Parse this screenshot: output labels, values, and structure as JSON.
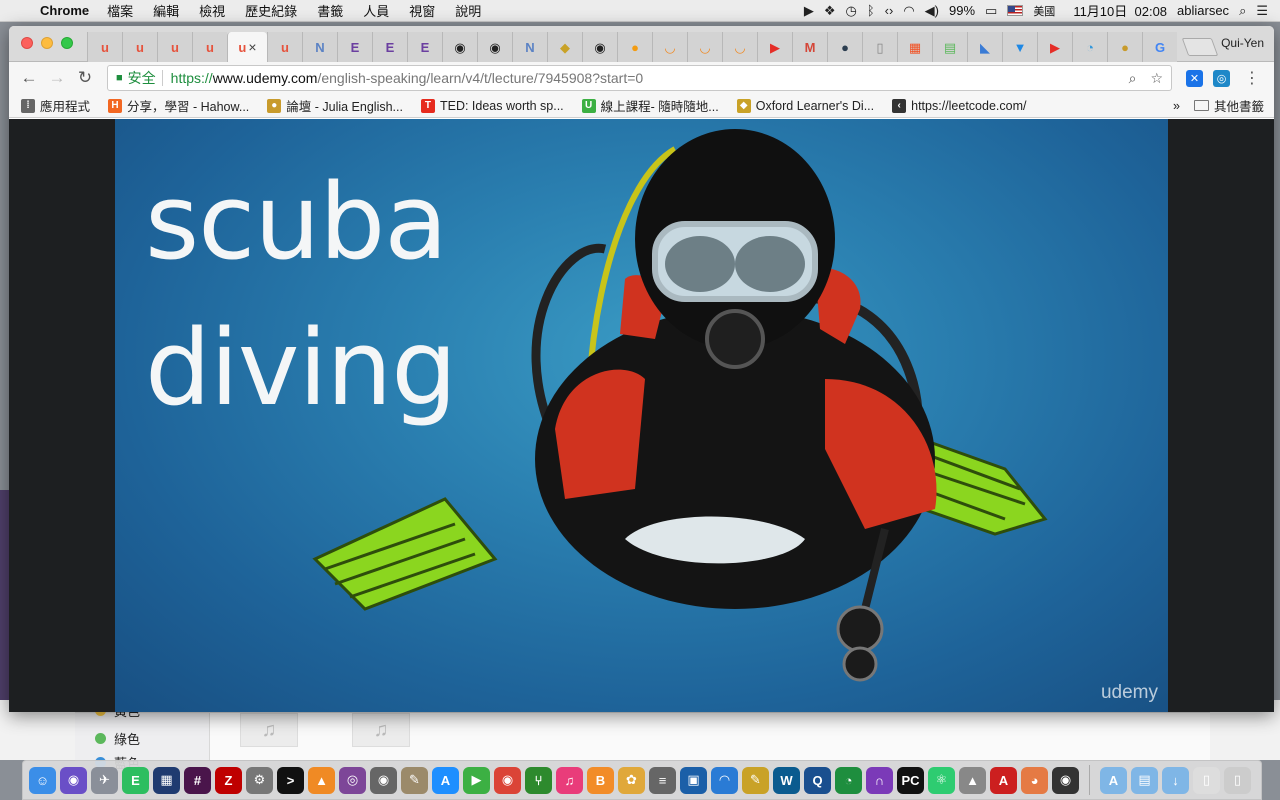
{
  "menubar": {
    "app_name": "Chrome",
    "menus": [
      "檔案",
      "編輯",
      "檢視",
      "歷史紀錄",
      "書籤",
      "人員",
      "視窗",
      "說明"
    ],
    "battery": "99%",
    "input_source": "美國",
    "clock": "11月10日  02:08",
    "user": "abliarsec"
  },
  "browser": {
    "profile": "Qui-Yen",
    "tabs": [
      {
        "icon": "udemy-icon",
        "glyph": "u",
        "color": "#e6533d"
      },
      {
        "icon": "udemy-icon",
        "glyph": "u",
        "color": "#e6533d"
      },
      {
        "icon": "udemy-icon",
        "glyph": "u",
        "color": "#e6533d"
      },
      {
        "icon": "udemy-icon",
        "glyph": "u",
        "color": "#e6533d"
      },
      {
        "icon": "udemy-icon",
        "glyph": "u",
        "color": "#e6533d",
        "active": true
      },
      {
        "icon": "udemy-icon",
        "glyph": "u",
        "color": "#e6533d"
      },
      {
        "icon": "nb-icon",
        "glyph": "N",
        "color": "#5b82c4"
      },
      {
        "icon": "e-icon",
        "glyph": "E",
        "color": "#6b3fa0"
      },
      {
        "icon": "e-icon",
        "glyph": "E",
        "color": "#6b3fa0"
      },
      {
        "icon": "e-icon",
        "glyph": "E",
        "color": "#6b3fa0"
      },
      {
        "icon": "github-icon",
        "glyph": "◉",
        "color": "#222222"
      },
      {
        "icon": "github-icon",
        "glyph": "◉",
        "color": "#222222"
      },
      {
        "icon": "nb-icon",
        "glyph": "N",
        "color": "#5b82c4"
      },
      {
        "icon": "oxford-icon",
        "glyph": "◆",
        "color": "#c9a227"
      },
      {
        "icon": "github-icon",
        "glyph": "◉",
        "color": "#222222"
      },
      {
        "icon": "d4-icon",
        "glyph": "●",
        "color": "#f39c12"
      },
      {
        "icon": "orange-ring-icon",
        "glyph": "◡",
        "color": "#f08a24"
      },
      {
        "icon": "orange-ring-icon",
        "glyph": "◡",
        "color": "#f08a24"
      },
      {
        "icon": "orange-ring-icon",
        "glyph": "◡",
        "color": "#f08a24"
      },
      {
        "icon": "youtube-icon",
        "glyph": "▶",
        "color": "#e52d27"
      },
      {
        "icon": "gmail-icon",
        "glyph": "M",
        "color": "#d44638"
      },
      {
        "icon": "dark-circle-icon",
        "glyph": "●",
        "color": "#2c3e50"
      },
      {
        "icon": "page-icon",
        "glyph": "▯",
        "color": "#888888"
      },
      {
        "icon": "microsoft-icon",
        "glyph": "▦",
        "color": "#f25022"
      },
      {
        "icon": "sheet-icon",
        "glyph": "▤",
        "color": "#5cb85c"
      },
      {
        "icon": "blue-book-icon",
        "glyph": "◣",
        "color": "#3a7bd5"
      },
      {
        "icon": "filter-icon",
        "glyph": "▼",
        "color": "#1e88e5"
      },
      {
        "icon": "youtube-icon",
        "glyph": "▶",
        "color": "#e52d27"
      },
      {
        "icon": "swirl-icon",
        "glyph": "◔",
        "color": "#3498db"
      },
      {
        "icon": "lb-icon",
        "glyph": "●",
        "color": "#c89b2c"
      },
      {
        "icon": "google-icon",
        "glyph": "G",
        "color": "#4285f4"
      }
    ],
    "omnibox": {
      "secure_label": "安全",
      "url_scheme": "https://",
      "url_host": "www.udemy.com",
      "url_path": "/english-speaking/learn/v4/t/lecture/7945908?start=0"
    },
    "bookmarks": [
      {
        "icon": "apps-grid-icon",
        "label": "應用程式",
        "color": "#666666",
        "glyph": "⁞"
      },
      {
        "icon": "hahow-icon",
        "label": "分享，學習 - Hahow...",
        "color": "#f26722",
        "glyph": "H"
      },
      {
        "icon": "lb-icon",
        "label": "論壇 - Julia English...",
        "color": "#c89b2c",
        "glyph": "●"
      },
      {
        "icon": "ted-icon",
        "label": "TED: Ideas worth sp...",
        "color": "#e62b1e",
        "glyph": "T"
      },
      {
        "icon": "u-green-icon",
        "label": "線上課程- 隨時隨地...",
        "color": "#3cb043",
        "glyph": "U"
      },
      {
        "icon": "oxford-icon",
        "label": "Oxford Learner's Di...",
        "color": "#c9a227",
        "glyph": "◆"
      },
      {
        "icon": "leetcode-icon",
        "label": "https://leetcode.com/",
        "color": "#333333",
        "glyph": "‹"
      }
    ],
    "other_bookmarks": "其他書籤"
  },
  "video": {
    "caption_line1": "scuba",
    "caption_line2": "diving",
    "watermark": "udemy"
  },
  "background_finder": {
    "tags": [
      {
        "label": "黃色",
        "color": "#f5c542"
      },
      {
        "label": "綠色",
        "color": "#5cb85c"
      },
      {
        "label": "藍色",
        "color": "#3a8fd8"
      }
    ]
  },
  "dock": {
    "apps": [
      {
        "name": "finder-icon",
        "color": "#3b8ee8",
        "glyph": "☺"
      },
      {
        "name": "siri-icon",
        "color": "#6a4fc7",
        "glyph": "◉"
      },
      {
        "name": "launchpad-icon",
        "color": "#8a8f99",
        "glyph": "✈"
      },
      {
        "name": "evernote-icon",
        "color": "#2dbe60",
        "glyph": "E"
      },
      {
        "name": "window-app-icon",
        "color": "#1f3b70",
        "glyph": "▦"
      },
      {
        "name": "slack-icon",
        "color": "#4a154b",
        "glyph": "#"
      },
      {
        "name": "filezilla-icon",
        "color": "#bf0000",
        "glyph": "Z"
      },
      {
        "name": "system-preferences-icon",
        "color": "#777777",
        "glyph": "⚙"
      },
      {
        "name": "terminal-icon",
        "color": "#111111",
        "glyph": ">"
      },
      {
        "name": "vlc-icon",
        "color": "#f08a24",
        "glyph": "▲"
      },
      {
        "name": "tor-icon",
        "color": "#7d4698",
        "glyph": "◎"
      },
      {
        "name": "screenshot-icon",
        "color": "#666666",
        "glyph": "◉"
      },
      {
        "name": "preview-icon",
        "color": "#9b8a6a",
        "glyph": "✎"
      },
      {
        "name": "app-store-icon",
        "color": "#1e8fff",
        "glyph": "A"
      },
      {
        "name": "facetime-icon",
        "color": "#3cb043",
        "glyph": "▶"
      },
      {
        "name": "chrome-icon",
        "color": "#db4437",
        "glyph": "◉"
      },
      {
        "name": "sourcetree-icon",
        "color": "#2d8a2d",
        "glyph": "⑂"
      },
      {
        "name": "itunes-icon",
        "color": "#e93c7a",
        "glyph": "♫"
      },
      {
        "name": "ibooks-icon",
        "color": "#f28c28",
        "glyph": "B"
      },
      {
        "name": "photos-icon",
        "color": "#e0a83a",
        "glyph": "✿"
      },
      {
        "name": "database-icon",
        "color": "#666666",
        "glyph": "≡"
      },
      {
        "name": "virtualbox-icon",
        "color": "#1b5fa8",
        "glyph": "▣"
      },
      {
        "name": "wifi-app-icon",
        "color": "#2a7bd5",
        "glyph": "◠"
      },
      {
        "name": "notes-icon",
        "color": "#c9a227",
        "glyph": "✎"
      },
      {
        "name": "w-app-icon",
        "color": "#0a5b8f",
        "glyph": "W"
      },
      {
        "name": "search-app-icon",
        "color": "#1a4f8f",
        "glyph": "Q"
      },
      {
        "name": "stats-icon",
        "color": "#1e8e3e",
        "glyph": "◔"
      },
      {
        "name": "headphones-icon",
        "color": "#7b3ab8",
        "glyph": "∩"
      },
      {
        "name": "pycharm-icon",
        "color": "#111111",
        "glyph": "PC"
      },
      {
        "name": "atom-icon",
        "color": "#2ecc71",
        "glyph": "⚛"
      },
      {
        "name": "rocket-icon",
        "color": "#888888",
        "glyph": "▲"
      },
      {
        "name": "acrobat-icon",
        "color": "#cc1f1f",
        "glyph": "A"
      },
      {
        "name": "toggl-icon",
        "color": "#e57a44",
        "glyph": "◕"
      },
      {
        "name": "panda-icon",
        "color": "#333333",
        "glyph": "◉"
      }
    ],
    "right_items": [
      {
        "name": "applications-folder-icon",
        "color": "#7fb6e6",
        "glyph": "A"
      },
      {
        "name": "documents-folder-icon",
        "color": "#7fb6e6",
        "glyph": "▤"
      },
      {
        "name": "downloads-folder-icon",
        "color": "#7fb6e6",
        "glyph": "↓"
      },
      {
        "name": "stack-icon",
        "color": "#dddddd",
        "glyph": "▯"
      },
      {
        "name": "trash-icon",
        "color": "#cccccc",
        "glyph": "▯"
      }
    ]
  }
}
